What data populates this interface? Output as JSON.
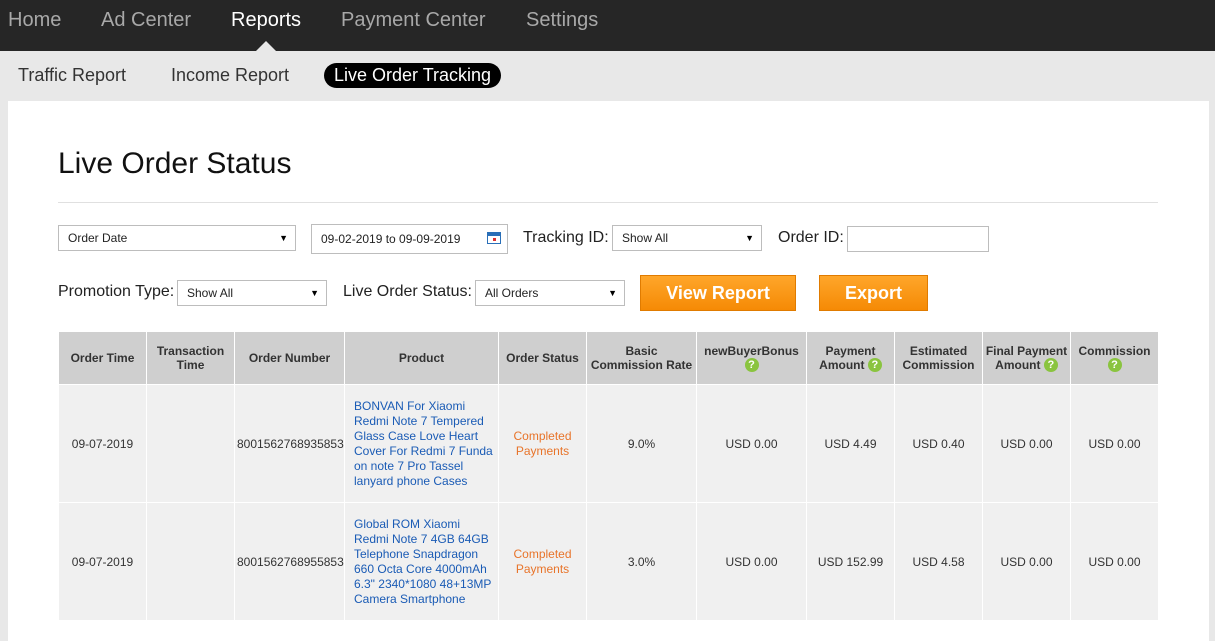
{
  "top_nav": [
    {
      "label": "Home"
    },
    {
      "label": "Ad Center"
    },
    {
      "label": "Reports"
    },
    {
      "label": "Payment Center"
    },
    {
      "label": "Settings"
    }
  ],
  "active_top_nav": "Reports",
  "sub_nav": [
    {
      "label": "Traffic Report"
    },
    {
      "label": "Income Report"
    },
    {
      "label": "Live Order Tracking"
    }
  ],
  "active_sub_nav": "Live Order Tracking",
  "page_title": "Live Order Status",
  "filters": {
    "date_type_value": "Order Date",
    "date_range_value": "09-02-2019 to 09-09-2019",
    "tracking_id_label": "Tracking ID:",
    "tracking_id_value": "Show All",
    "order_id_label": "Order ID:",
    "order_id_value": "",
    "promotion_type_label": "Promotion Type:",
    "promotion_type_value": "Show All",
    "live_order_status_label": "Live Order Status:",
    "live_order_status_value": "All Orders"
  },
  "buttons": {
    "view_report": "View Report",
    "export": "Export"
  },
  "icons": {
    "dropdown": "caret-down-icon",
    "calendar": "calendar-icon",
    "help": "question-circle-icon"
  },
  "colors": {
    "nav_bg": "#262626",
    "accent_orange": "#f7931e",
    "status_orange": "#e8742a",
    "link_blue": "#1a5bb5",
    "help_green": "#8ac43f"
  },
  "table": {
    "headers": [
      "Order Time",
      "Transaction Time",
      "Order Number",
      "Product",
      "Order Status",
      "Basic Commission Rate",
      "newBuyerBonus",
      "Payment Amount",
      "Estimated Commission",
      "Final Payment Amount",
      "Commission"
    ],
    "rows": [
      {
        "order_time": "09-07-2019",
        "transaction_time": "",
        "order_number": "8001562768935853",
        "product": "BONVAN For Xiaomi Redmi Note 7 Tempered Glass Case Love Heart Cover For Redmi 7 Funda on note 7 Pro Tassel lanyard phone Cases",
        "order_status": "Completed Payments",
        "basic_commission_rate": "9.0%",
        "new_buyer_bonus": "USD 0.00",
        "payment_amount": "USD 4.49",
        "estimated_commission": "USD 0.40",
        "final_payment_amount": "USD 0.00",
        "commission": "USD 0.00"
      },
      {
        "order_time": "09-07-2019",
        "transaction_time": "",
        "order_number": "8001562768955853",
        "product": "Global ROM Xiaomi Redmi Note 7 4GB 64GB Telephone Snapdragon 660 Octa Core 4000mAh 6.3\" 2340*1080 48+13MP Camera Smartphone",
        "order_status": "Completed Payments",
        "basic_commission_rate": "3.0%",
        "new_buyer_bonus": "USD 0.00",
        "payment_amount": "USD 152.99",
        "estimated_commission": "USD 4.58",
        "final_payment_amount": "USD 0.00",
        "commission": "USD 0.00"
      }
    ]
  }
}
